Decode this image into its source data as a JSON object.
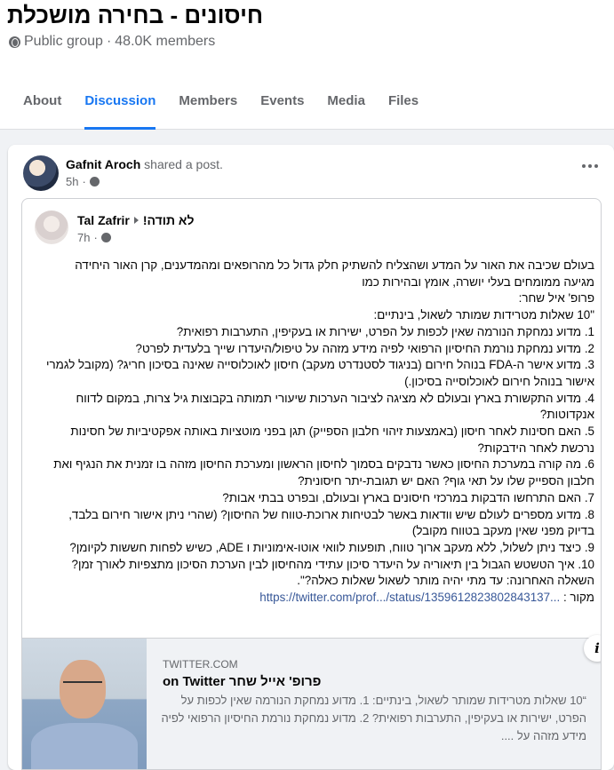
{
  "group": {
    "title": "חיסונים - בחירה מושכלת",
    "privacy": "Public group",
    "separator": "·",
    "members": "48.0K members"
  },
  "tabs": [
    {
      "label": "About"
    },
    {
      "label": "Discussion",
      "active": true
    },
    {
      "label": "Members"
    },
    {
      "label": "Events"
    },
    {
      "label": "Media"
    },
    {
      "label": "Files"
    }
  ],
  "post": {
    "author": "Gafnit Aroch",
    "action": "shared a post.",
    "time": "5h",
    "dot": "·"
  },
  "shared": {
    "author": "Tal Zafrir",
    "feeling": "לא תודה!",
    "time": "7h",
    "dot": "·",
    "body": [
      "בעולם שכיבה את האור על המדע ושהצליח להשתיק חלק גדול כל מהרופאים ומהמדענים, קרן האור היחידה מגיעה ממומחים בעלי יושרה, אומץ ובהירות כמו",
      "פרופ' איל שחר:",
      "\"10 שאלות מטרידות שמותר לשאול, בינתיים:",
      "1. מדוע נמחקת הנורמה שאין לכפות על הפרט, ישירות או בעקיפין, התערבות רפואית?",
      "2. מדוע נמחקת נורמת החיסיון הרפואי לפיה מידע מזהה על טיפול/היעדרו שייך בלעדית לפרט?",
      "3. מדוע אישר ה-FDA בנוהל חירום (בניגוד לסטנדרט מעקב) חיסון לאוכלוסייה שאינה בסיכון חריג? (מקובל לגמרי אישור בנוהל חירום לאוכלוסייה בסיכון.)",
      "4. מדוע התקשורת בארץ ובעולם לא מציגה לציבור הערכות שיעורי תמותה בקבוצות גיל צרות, במקום לדווח אנקדוטות?",
      "5. האם חסינות לאחר חיסון (באמצעות זיהוי חלבון הספייק) תגן בפני מוטציות באותה אפקטיביות של חסינות נרכשת לאחר הידבקות?",
      "6. מה קורה במערכת החיסון כאשר נדבקים בסמוך לחיסון הראשון ומערכת החיסון מזהה בו זמנית את הנגיף ואת חלבון הספייק שלו על תאי גוף? האם יש תגובת-יתר חיסונית?",
      "7. האם התרחשו הדבקות במרכזי חיסונים בארץ ובעולם, ובפרט בבתי אבות?",
      "8. מדוע מספרים לעולם שיש וודאות באשר לבטיחות ארוכת-טווח של החיסון? (שהרי ניתן אישור חירום בלבד, בדיוק מפני שאין מעקב בטווח מקובל)",
      "9. כיצד ניתן לשלול, ללא מעקב ארוך טווח, תופעות לוואי אוטו-אימוניות ו ADE, כשיש לפחות חששות לקיומן?",
      "10. איך הטשטש הגבול בין תיאוריה על היעדר סיכון עתידי מהחיסון לבין הערכת הסיכון מתצפיות לאורך זמן?",
      "השאלה האחרונה: עד מתי יהיה מותר לשאול שאלות כאלה?\"."
    ],
    "source_label": "מקור :",
    "source_link": "https://twitter.com/prof.../status/1359612823802843137...",
    "source_ellipsis": "..."
  },
  "preview": {
    "domain": "TWITTER.COM",
    "title_name": "פרופ' אייל שחר",
    "title_suffix": "on Twitter",
    "description": "“10 שאלות מטרידות שמותר לשאול, בינתיים: 1. מדוע נמחקת הנורמה שאין לכפות על הפרט, ישירות או בעקיפין, התערבות רפואית? 2. מדוע נמחקת נורמת החיסיון הרפואי לפיה מידע מזהה על ....",
    "info_glyph": "i"
  },
  "colors": {
    "accent": "#1877f2",
    "link": "#385898",
    "secondary_text": "#65676b",
    "background": "#f0f2f5"
  },
  "icons": [
    "globe-icon",
    "more-icon",
    "caret-right-icon",
    "info-icon",
    "avatar"
  ]
}
